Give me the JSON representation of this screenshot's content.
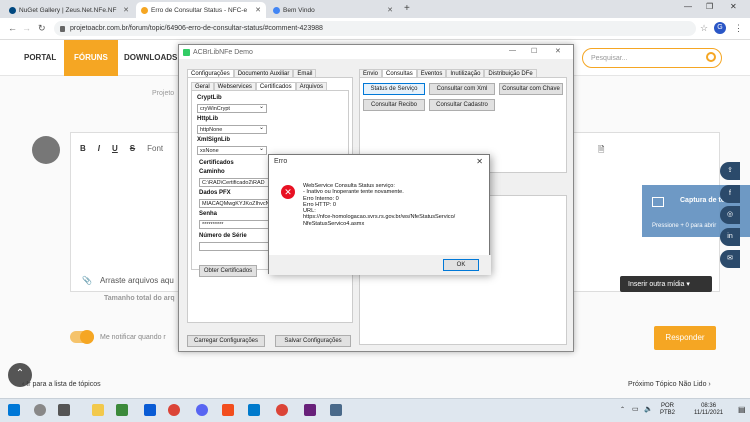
{
  "browser": {
    "tabs": [
      {
        "title": "NuGet Gallery | Zeus.Net.NFe.NF",
        "active": false
      },
      {
        "title": "Erro de Consultar Status - NFC-e",
        "active": true
      },
      {
        "title": "Bem Vindo",
        "active": false
      }
    ],
    "url": "projetoacbr.com.br/forum/topic/64906-erro-de-consultar-status/#comment-423988",
    "profile_initial": "G"
  },
  "site": {
    "nav": [
      "PORTAL",
      "FÓRUNS",
      "DOWNLOADS"
    ],
    "search_placeholder": "Pesquisar...",
    "brand_partial": "Projeto",
    "editor_toolbar": [
      "B",
      "I",
      "U",
      "S"
    ],
    "editor_font_partial": "Font",
    "attach_label": "Arraste arquivos aqu",
    "total_size_label": "Tamanho total do arq",
    "insert_media": "Inserir outra mídia",
    "notify_label": "Me notificar quando r",
    "reply_button": "Responder",
    "prev_topic": "Ir para a lista de tópicos",
    "next_topic": "Próximo Tópico Não Lido",
    "screenshot_overlay": {
      "title": "Captura de tela",
      "hint": "Pressione + 0 para abrir"
    }
  },
  "app": {
    "title": "ACBrLibNFe Demo",
    "left_tabs": [
      "Configurações",
      "Documento Auxiliar",
      "Email"
    ],
    "sub_tabs": [
      "Geral",
      "Webservices",
      "Certificados",
      "Arquivos"
    ],
    "fields": {
      "cryptlib_label": "CryptLib",
      "cryptlib_value": "cryWinCrypt",
      "httplib_label": "HttpLib",
      "httplib_value": "httpNone",
      "xmlsignlib_label": "XmlSignLib",
      "xmlsignlib_value": "xsNone",
      "certificados_label": "Certificados",
      "caminho_label": "Caminho",
      "caminho_value": "C:\\RAD\\Certificado2\\RAD",
      "dados_pfx_label": "Dados PFX",
      "dados_pfx_value": "MIACAQMwgKYJKoZIhvcN",
      "senha_label": "Senha",
      "senha_value": "**********",
      "numero_serie_label": "Número de Série"
    },
    "obter_certificados": "Obter Certificados",
    "carregar_config": "Carregar Configurações",
    "salvar_config": "Salvar Configurações",
    "right_tabs": [
      "Envio",
      "Consultas",
      "Eventos",
      "Inutilização",
      "Distribuição DFe"
    ],
    "consultas_buttons": [
      "Status de Serviço",
      "Consultar com Xml",
      "Consultar com Chave",
      "Consultar Recibo",
      "Consultar Cadastro"
    ]
  },
  "dialog": {
    "title": "Erro",
    "lines": [
      "WebService Consulta Status serviço:",
      "- Inativo ou Inoperante tente novamente.",
      "Erro Interno: 0",
      "Erro HTTP: 0",
      "URL:",
      "https://nfce-homologacao.svrs.rs.gov.br/ws/NfeStatusServico/",
      "NfeStatusServico4.asmx"
    ],
    "ok": "OK"
  },
  "taskbar": {
    "lang": "POR",
    "layout": "PTB2",
    "time": "08:36",
    "date": "11/11/2021"
  }
}
